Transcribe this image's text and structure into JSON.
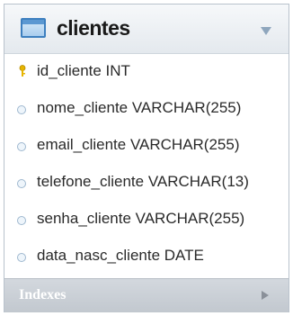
{
  "table": {
    "name": "clientes",
    "columns": [
      {
        "text": "id_cliente INT",
        "icon": "primary-key-icon"
      },
      {
        "text": "nome_cliente VARCHAR(255)",
        "icon": "column-dot-icon"
      },
      {
        "text": "email_cliente VARCHAR(255)",
        "icon": "column-dot-icon"
      },
      {
        "text": "telefone_cliente VARCHAR(13)",
        "icon": "column-dot-icon"
      },
      {
        "text": "senha_cliente VARCHAR(255)",
        "icon": "column-dot-icon"
      },
      {
        "text": "data_nasc_cliente DATE",
        "icon": "column-dot-icon"
      }
    ],
    "indexes_label": "Indexes"
  },
  "colors": {
    "header_gradient_top": "#f6f8fa",
    "header_gradient_bottom": "#e4e9ee",
    "table_icon_blue": "#3d7fbf",
    "primary_key_yellow": "#e6b400",
    "indexes_bar": "#c8cdd3"
  }
}
